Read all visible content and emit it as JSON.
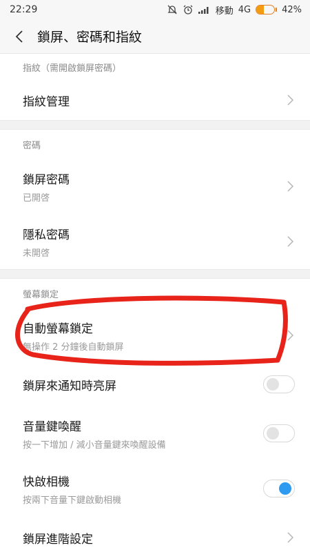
{
  "status_bar": {
    "time": "22:29",
    "carrier": "移動",
    "network": "4G",
    "battery_text": "42%",
    "battery_level": 0.42,
    "icons": [
      "mute-icon",
      "alarm-icon",
      "signal-icon"
    ]
  },
  "header": {
    "title": "鎖屏、密碼和指紋"
  },
  "sections": {
    "fingerprint": {
      "header": "指紋（需開啟鎖屏密碼）",
      "items": [
        {
          "title": "指紋管理"
        }
      ]
    },
    "password": {
      "header": "密碼",
      "items": [
        {
          "title": "鎖屏密碼",
          "subtitle": "已開啓"
        },
        {
          "title": "隱私密碼",
          "subtitle": "未開啓"
        }
      ]
    },
    "screen_lock": {
      "header": "螢幕鎖定",
      "items": [
        {
          "title": "自動螢幕鎖定",
          "subtitle": "無操作 2 分鐘後自動鎖屏"
        },
        {
          "title": "鎖屏來通知時亮屏",
          "toggle": false
        },
        {
          "title": "音量鍵喚醒",
          "subtitle": "按一下增加 / 減小音量鍵來喚醒設備",
          "toggle": false
        },
        {
          "title": "快啟相機",
          "subtitle": "按兩下音量下鍵啟動相機",
          "toggle": true
        },
        {
          "title": "鎖屏進階設定"
        }
      ]
    }
  },
  "annotation": {
    "color": "#e8231a",
    "shape": "hand-drawn ellipse around 自動螢幕鎖定"
  },
  "colors": {
    "accent": "#2e9bf0",
    "battery": "#f39c12"
  }
}
